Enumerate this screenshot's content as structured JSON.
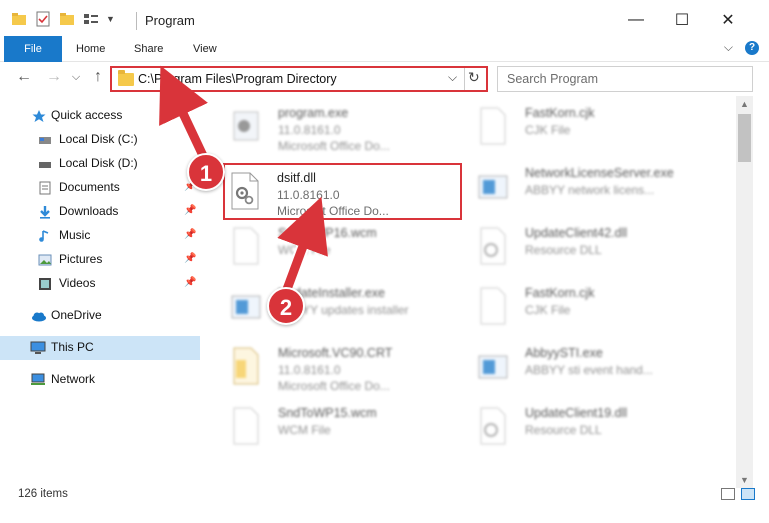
{
  "window": {
    "title": "Program",
    "minimize": "—",
    "maximize": "☐",
    "close": "✕"
  },
  "ribbon": {
    "tabs": [
      "File",
      "Home",
      "Share",
      "View"
    ],
    "expand": "⌵",
    "help": "?"
  },
  "nav": {
    "back": "←",
    "forward": "→",
    "recent": "⌵",
    "up": "↑"
  },
  "address": {
    "path": "C:\\Program Files\\Program Directory",
    "dropdown": "⌵",
    "refresh": "↻"
  },
  "search": {
    "placeholder": "Search Program"
  },
  "navpane": {
    "items": [
      {
        "label": "Quick access",
        "icon": "star-icon",
        "pinned": false
      },
      {
        "label": "Local Disk (C:)",
        "icon": "drive-icon",
        "pinned": false
      },
      {
        "label": "Local Disk (D:)",
        "icon": "drive-icon",
        "pinned": false
      },
      {
        "label": "Documents",
        "icon": "documents-icon",
        "pinned": true
      },
      {
        "label": "Downloads",
        "icon": "download-icon",
        "pinned": true
      },
      {
        "label": "Music",
        "icon": "music-icon",
        "pinned": true
      },
      {
        "label": "Pictures",
        "icon": "pictures-icon",
        "pinned": true
      },
      {
        "label": "Videos",
        "icon": "videos-icon",
        "pinned": true
      },
      {
        "label": "OneDrive",
        "icon": "cloud-icon",
        "pinned": false
      },
      {
        "label": "This PC",
        "icon": "computer-icon",
        "pinned": false
      },
      {
        "label": "Network",
        "icon": "network-icon",
        "pinned": false
      }
    ],
    "pin_glyph": "📌"
  },
  "files": [
    {
      "name": "program.exe",
      "line1": "11.0.8161.0",
      "line2": "Microsoft Office Do...",
      "icon": "exe-icon"
    },
    {
      "name": "FastKorn.cjk",
      "line1": "CJK File",
      "line2": "",
      "icon": "blank-file-icon"
    },
    {
      "name": "dsitf.dll",
      "line1": "11.0.8161.0",
      "line2": "Microsoft Office Do...",
      "icon": "dll-gear-icon"
    },
    {
      "name": "NetworkLicenseServer.exe",
      "line1": "ABBYY network licens...",
      "line2": "",
      "icon": "exe-icon"
    },
    {
      "name": "SndToWP16.wcm",
      "line1": "WCM File",
      "line2": "",
      "icon": "blank-file-icon"
    },
    {
      "name": "UpdateClient42.dll",
      "line1": "Resource DLL",
      "line2": "",
      "icon": "dll-gear-icon"
    },
    {
      "name": "UpdateInstaller.exe",
      "line1": "ABBYY updates installer",
      "line2": "",
      "icon": "exe-icon"
    },
    {
      "name": "FastKorn.cjk",
      "line1": "CJK File",
      "line2": "",
      "icon": "blank-file-icon"
    },
    {
      "name": "Microsoft.VC90.CRT",
      "line1": "11.0.8161.0",
      "line2": "Microsoft Office Do...",
      "icon": "folder-file-icon"
    },
    {
      "name": "AbbyySTI.exe",
      "line1": "ABBYY sti event hand...",
      "line2": "",
      "icon": "exe-icon"
    },
    {
      "name": "SndToWP15.wcm",
      "line1": "WCM File",
      "line2": "",
      "icon": "blank-file-icon"
    },
    {
      "name": "UpdateClient19.dll",
      "line1": "Resource DLL",
      "line2": "",
      "icon": "dll-gear-icon"
    }
  ],
  "status": {
    "count": "126 items"
  },
  "callouts": [
    "1",
    "2"
  ],
  "colors": {
    "accent": "#1979ca",
    "highlight": "#d9343a",
    "selected_nav": "#cce4f7"
  }
}
